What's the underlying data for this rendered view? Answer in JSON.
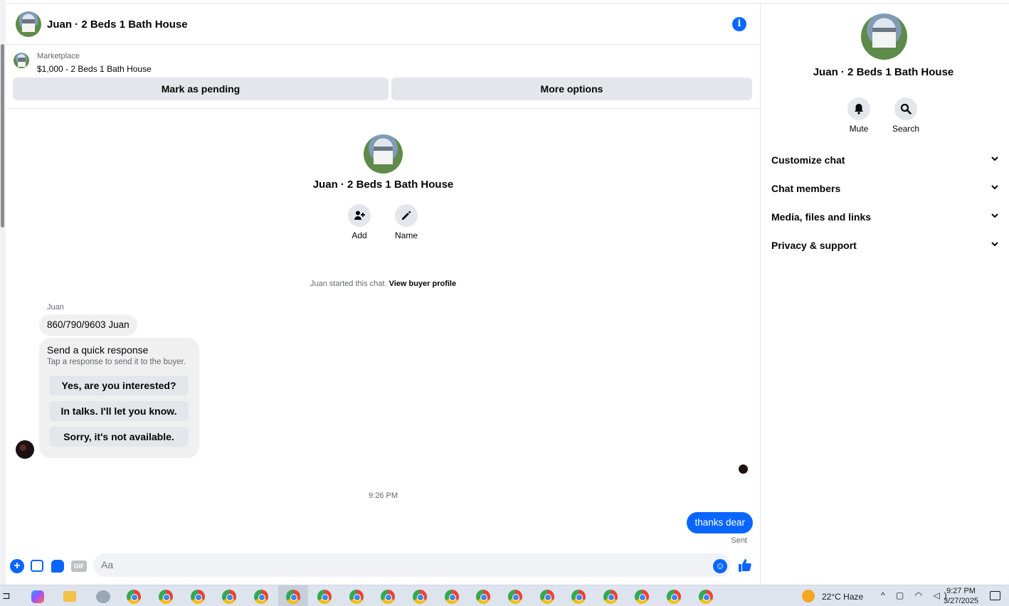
{
  "chat": {
    "title": "Juan · 2 Beds 1 Bath House",
    "marketplace_label": "Marketplace",
    "listing": "$1,000 - 2 Beds 1 Bath House",
    "mark_pending_label": "Mark as pending",
    "more_options_label": "More options",
    "center_title": "Juan · 2 Beds 1 Bath House",
    "add_label": "Add",
    "name_label": "Name",
    "started_text": "Juan started this chat.",
    "view_profile_label": "View buyer profile",
    "sender_name": "Juan",
    "incoming_message": "860/790/9603 Juan",
    "quick_title": "Send a quick response",
    "quick_subtitle": "Tap a response to send it to the buyer.",
    "quick_options": [
      "Yes, are you interested?",
      "In talks. I'll let you know.",
      "Sorry, it's not available."
    ],
    "timestamp": "9:26 PM",
    "outgoing_message": "thanks dear",
    "sent_status": "Sent",
    "composer_placeholder": "Aa",
    "gif_label": "GIF"
  },
  "panel": {
    "title": "Juan · 2 Beds 1 Bath House",
    "mute_label": "Mute",
    "search_label": "Search",
    "sections": [
      "Customize chat",
      "Chat members",
      "Media, files and links",
      "Privacy & support"
    ]
  },
  "taskbar": {
    "weather": "22°C  Haze",
    "time": "9:27 PM",
    "date": "3/27/2025"
  },
  "colors": {
    "accent": "#0866ff",
    "bubble_gray": "#f0f0f0",
    "button_gray": "#e4e6eb"
  },
  "icons": [
    "info-icon",
    "add-person-icon",
    "pencil-icon",
    "bell-icon",
    "search-icon",
    "chevron-down-icon",
    "plus-icon",
    "photo-icon",
    "sticker-icon",
    "gif-icon",
    "emoji-icon",
    "thumbs-up-icon"
  ]
}
